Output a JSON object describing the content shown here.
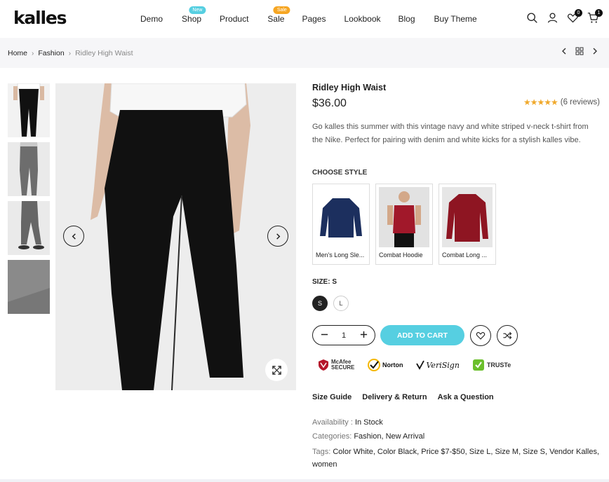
{
  "header": {
    "logo": "kalles",
    "nav": [
      {
        "label": "Demo",
        "badge": ""
      },
      {
        "label": "Shop",
        "badge": "New"
      },
      {
        "label": "Product",
        "badge": ""
      },
      {
        "label": "Sale",
        "badge": "Sale"
      },
      {
        "label": "Pages",
        "badge": ""
      },
      {
        "label": "Lookbook",
        "badge": ""
      },
      {
        "label": "Blog",
        "badge": ""
      },
      {
        "label": "Buy Theme",
        "badge": ""
      }
    ],
    "badge_colors": {
      "new": "#56cfe1",
      "sale": "#f6a623"
    },
    "wishlist_count": "0",
    "cart_count": "1",
    "icons": [
      "search-icon",
      "user-icon",
      "heart-icon",
      "cart-icon"
    ]
  },
  "breadcrumb": {
    "items": [
      "Home",
      "Fashion"
    ],
    "current": "Ridley High Waist"
  },
  "product": {
    "title": "Ridley High Waist",
    "price": "$36.00",
    "rating": 4.5,
    "stars": "★★★★★",
    "reviews": "(6 reviews)",
    "description": "Go kalles this summer with this vintage navy and white striped v-neck t-shirt from the Nike. Perfect for pairing with denim and white kicks for a stylish kalles vibe.",
    "style_label": "CHOOSE STYLE",
    "styles": [
      {
        "label": "Men's Long Sle...",
        "color": "#1c2f5e"
      },
      {
        "label": "Combat Hoodie",
        "color": "#a1182a"
      },
      {
        "label": "Combat Long ...",
        "color": "#8e1522"
      }
    ],
    "size_label": "SIZE: S",
    "sizes": [
      "S",
      "L"
    ],
    "selected_size": "S",
    "quantity": "1",
    "add_to_cart": "ADD TO CART",
    "accent_color": "#56cfe1",
    "trust_badges": [
      "McAfee SECURE",
      "Norton",
      "VeriSign",
      "TRUSTe"
    ],
    "links": [
      "Size Guide",
      "Delivery & Return",
      "Ask a Question"
    ],
    "availability_label": "Availability :",
    "availability_value": "In Stock",
    "categories_label": "Categories:",
    "categories": "Fashion, New Arrival",
    "tags_label": "Tags:",
    "tags": "Color White, Color Black, Price $7-$50, Size L, Size M, Size S, Vendor Kalles, women"
  }
}
